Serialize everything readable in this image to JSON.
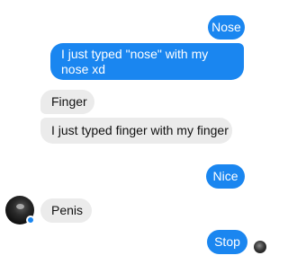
{
  "messages": [
    {
      "id": "nose",
      "sender": "me",
      "text": "Nose"
    },
    {
      "id": "typed-nose",
      "sender": "me",
      "text": "I just typed \"nose\" with my nose xd"
    },
    {
      "id": "finger",
      "sender": "other",
      "text": "Finger"
    },
    {
      "id": "typed-finger",
      "sender": "other",
      "text": "I just typed finger with my finger"
    },
    {
      "id": "nice",
      "sender": "me",
      "text": "Nice"
    },
    {
      "id": "penis",
      "sender": "other",
      "text": "Penis"
    },
    {
      "id": "stop",
      "sender": "me",
      "text": "Stop"
    }
  ],
  "colors": {
    "outgoing_bubble": "#1a86f0",
    "incoming_bubble": "#ebebeb",
    "active_status": "#1a86f0"
  },
  "icons": {
    "contact_avatar": "avatar-photo",
    "active_status": "active-dot",
    "read_receipt": "read-receipt-avatar"
  }
}
